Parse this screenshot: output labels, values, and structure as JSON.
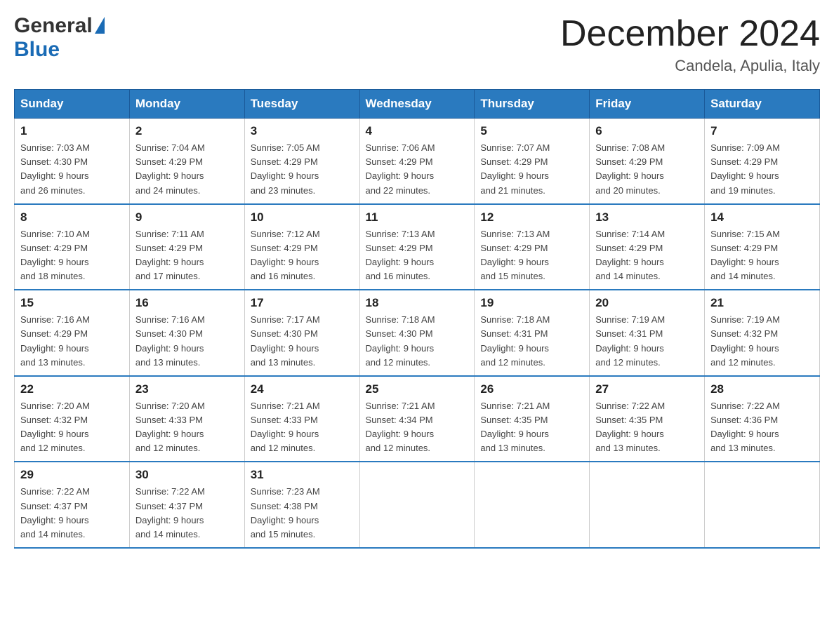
{
  "logo": {
    "general": "General",
    "triangle": "▶",
    "blue": "Blue"
  },
  "header": {
    "month": "December 2024",
    "location": "Candela, Apulia, Italy"
  },
  "days_of_week": [
    "Sunday",
    "Monday",
    "Tuesday",
    "Wednesday",
    "Thursday",
    "Friday",
    "Saturday"
  ],
  "weeks": [
    [
      {
        "day": "1",
        "sunrise": "7:03 AM",
        "sunset": "4:30 PM",
        "daylight": "9 hours and 26 minutes."
      },
      {
        "day": "2",
        "sunrise": "7:04 AM",
        "sunset": "4:29 PM",
        "daylight": "9 hours and 24 minutes."
      },
      {
        "day": "3",
        "sunrise": "7:05 AM",
        "sunset": "4:29 PM",
        "daylight": "9 hours and 23 minutes."
      },
      {
        "day": "4",
        "sunrise": "7:06 AM",
        "sunset": "4:29 PM",
        "daylight": "9 hours and 22 minutes."
      },
      {
        "day": "5",
        "sunrise": "7:07 AM",
        "sunset": "4:29 PM",
        "daylight": "9 hours and 21 minutes."
      },
      {
        "day": "6",
        "sunrise": "7:08 AM",
        "sunset": "4:29 PM",
        "daylight": "9 hours and 20 minutes."
      },
      {
        "day": "7",
        "sunrise": "7:09 AM",
        "sunset": "4:29 PM",
        "daylight": "9 hours and 19 minutes."
      }
    ],
    [
      {
        "day": "8",
        "sunrise": "7:10 AM",
        "sunset": "4:29 PM",
        "daylight": "9 hours and 18 minutes."
      },
      {
        "day": "9",
        "sunrise": "7:11 AM",
        "sunset": "4:29 PM",
        "daylight": "9 hours and 17 minutes."
      },
      {
        "day": "10",
        "sunrise": "7:12 AM",
        "sunset": "4:29 PM",
        "daylight": "9 hours and 16 minutes."
      },
      {
        "day": "11",
        "sunrise": "7:13 AM",
        "sunset": "4:29 PM",
        "daylight": "9 hours and 16 minutes."
      },
      {
        "day": "12",
        "sunrise": "7:13 AM",
        "sunset": "4:29 PM",
        "daylight": "9 hours and 15 minutes."
      },
      {
        "day": "13",
        "sunrise": "7:14 AM",
        "sunset": "4:29 PM",
        "daylight": "9 hours and 14 minutes."
      },
      {
        "day": "14",
        "sunrise": "7:15 AM",
        "sunset": "4:29 PM",
        "daylight": "9 hours and 14 minutes."
      }
    ],
    [
      {
        "day": "15",
        "sunrise": "7:16 AM",
        "sunset": "4:29 PM",
        "daylight": "9 hours and 13 minutes."
      },
      {
        "day": "16",
        "sunrise": "7:16 AM",
        "sunset": "4:30 PM",
        "daylight": "9 hours and 13 minutes."
      },
      {
        "day": "17",
        "sunrise": "7:17 AM",
        "sunset": "4:30 PM",
        "daylight": "9 hours and 13 minutes."
      },
      {
        "day": "18",
        "sunrise": "7:18 AM",
        "sunset": "4:30 PM",
        "daylight": "9 hours and 12 minutes."
      },
      {
        "day": "19",
        "sunrise": "7:18 AM",
        "sunset": "4:31 PM",
        "daylight": "9 hours and 12 minutes."
      },
      {
        "day": "20",
        "sunrise": "7:19 AM",
        "sunset": "4:31 PM",
        "daylight": "9 hours and 12 minutes."
      },
      {
        "day": "21",
        "sunrise": "7:19 AM",
        "sunset": "4:32 PM",
        "daylight": "9 hours and 12 minutes."
      }
    ],
    [
      {
        "day": "22",
        "sunrise": "7:20 AM",
        "sunset": "4:32 PM",
        "daylight": "9 hours and 12 minutes."
      },
      {
        "day": "23",
        "sunrise": "7:20 AM",
        "sunset": "4:33 PM",
        "daylight": "9 hours and 12 minutes."
      },
      {
        "day": "24",
        "sunrise": "7:21 AM",
        "sunset": "4:33 PM",
        "daylight": "9 hours and 12 minutes."
      },
      {
        "day": "25",
        "sunrise": "7:21 AM",
        "sunset": "4:34 PM",
        "daylight": "9 hours and 12 minutes."
      },
      {
        "day": "26",
        "sunrise": "7:21 AM",
        "sunset": "4:35 PM",
        "daylight": "9 hours and 13 minutes."
      },
      {
        "day": "27",
        "sunrise": "7:22 AM",
        "sunset": "4:35 PM",
        "daylight": "9 hours and 13 minutes."
      },
      {
        "day": "28",
        "sunrise": "7:22 AM",
        "sunset": "4:36 PM",
        "daylight": "9 hours and 13 minutes."
      }
    ],
    [
      {
        "day": "29",
        "sunrise": "7:22 AM",
        "sunset": "4:37 PM",
        "daylight": "9 hours and 14 minutes."
      },
      {
        "day": "30",
        "sunrise": "7:22 AM",
        "sunset": "4:37 PM",
        "daylight": "9 hours and 14 minutes."
      },
      {
        "day": "31",
        "sunrise": "7:23 AM",
        "sunset": "4:38 PM",
        "daylight": "9 hours and 15 minutes."
      },
      null,
      null,
      null,
      null
    ]
  ],
  "labels": {
    "sunrise": "Sunrise:",
    "sunset": "Sunset:",
    "daylight": "Daylight:"
  }
}
